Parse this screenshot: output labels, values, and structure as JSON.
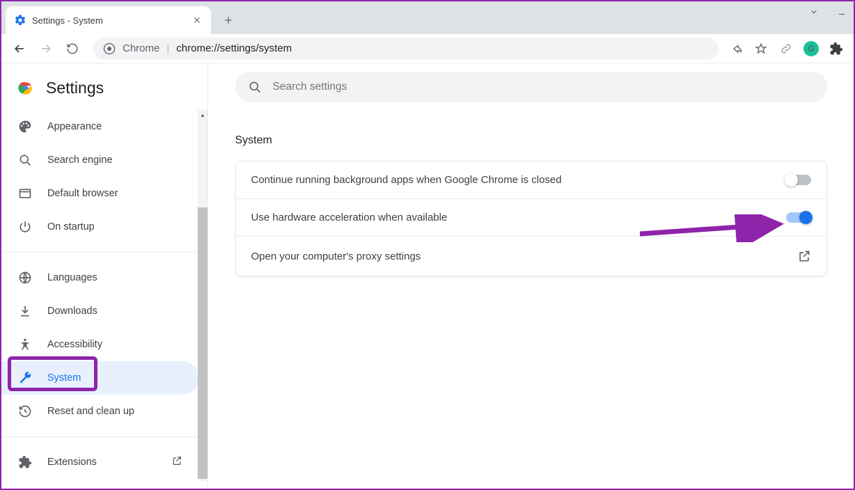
{
  "browser": {
    "tab_title": "Settings - System",
    "url_prefix": "Chrome",
    "url_path": "chrome://settings/system"
  },
  "app": {
    "title": "Settings",
    "search_placeholder": "Search settings"
  },
  "sidebar": {
    "items": [
      {
        "label": "Appearance"
      },
      {
        "label": "Search engine"
      },
      {
        "label": "Default browser"
      },
      {
        "label": "On startup"
      },
      {
        "label": "Languages"
      },
      {
        "label": "Downloads"
      },
      {
        "label": "Accessibility"
      },
      {
        "label": "System"
      },
      {
        "label": "Reset and clean up"
      },
      {
        "label": "Extensions"
      }
    ]
  },
  "main": {
    "section_title": "System",
    "rows": [
      {
        "label": "Continue running background apps when Google Chrome is closed"
      },
      {
        "label": "Use hardware acceleration when available"
      },
      {
        "label": "Open your computer's proxy settings"
      }
    ]
  },
  "annotation": {
    "highlight_sidebar_item": "System",
    "arrow_target": "hardware-acceleration-toggle",
    "color": "#8e24aa"
  }
}
